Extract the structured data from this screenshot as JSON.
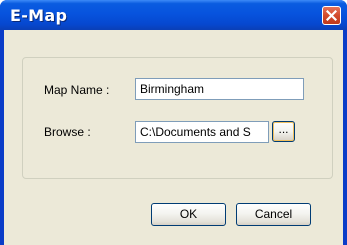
{
  "window": {
    "title": "E-Map",
    "close_icon": "close-icon"
  },
  "form": {
    "map_name_label": "Map Name :",
    "map_name_value": "Birmingham",
    "browse_label": "Browse :",
    "browse_path_value": "C:\\Documents and S",
    "browse_button_label": "..."
  },
  "buttons": {
    "ok_label": "OK",
    "cancel_label": "Cancel"
  },
  "colors": {
    "titlebar": "#0753de",
    "client_bg": "#ece9d8",
    "close_button": "#d24a2b"
  }
}
